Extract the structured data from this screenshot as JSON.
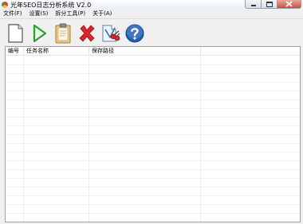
{
  "window": {
    "title": "光年SEO日志分析系统 V2.0"
  },
  "menu": [
    {
      "label": "文件(F)"
    },
    {
      "label": "设置(S)"
    },
    {
      "label": "拆分工具(P)"
    },
    {
      "label": "关于(A)"
    }
  ],
  "toolbar": [
    {
      "icon": "new-document-icon"
    },
    {
      "icon": "play-icon"
    },
    {
      "icon": "clipboard-icon"
    },
    {
      "icon": "delete-x-icon"
    },
    {
      "icon": "split-tool-icon"
    },
    {
      "icon": "help-icon"
    }
  ],
  "table": {
    "columns": [
      "编号",
      "任务名称",
      "保存路径"
    ],
    "rows": []
  },
  "colors": {
    "title_gradient_bottom": "#e9eef5",
    "play_green": "#2e9e2e",
    "delete_red": "#d9262c",
    "help_blue": "#1f5fb5",
    "clipboard_tan": "#d8b36a"
  }
}
